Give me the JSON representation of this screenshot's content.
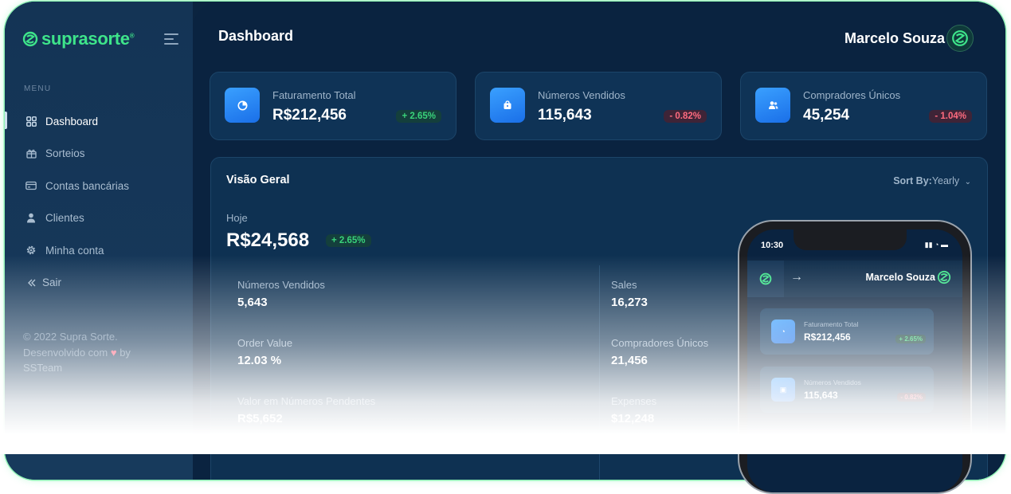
{
  "brand": {
    "name": "suprasorte",
    "mark": "®",
    "color": "#3ee48a"
  },
  "sidebar": {
    "menu_label": "MENU",
    "items": [
      {
        "label": "Dashboard",
        "icon": "grid-icon",
        "active": true
      },
      {
        "label": "Sorteios",
        "icon": "gift-icon"
      },
      {
        "label": "Contas bancárias",
        "icon": "credit-card-icon"
      },
      {
        "label": "Clientes",
        "icon": "user-icon"
      },
      {
        "label": "Minha conta",
        "icon": "gear-icon"
      },
      {
        "label": "Sair",
        "icon": "double-chevron-left-icon"
      }
    ],
    "footer": {
      "line1": "© 2022 Supra Sorte.",
      "line2a": "Desenvolvido com",
      "line2b": "by",
      "line3": "SSTeam"
    }
  },
  "header": {
    "title": "Dashboard",
    "user_name": "Marcelo Souza"
  },
  "cards": [
    {
      "label": "Faturamento Total",
      "value": "R$212,456",
      "change": "+ 2.65%",
      "trend": "up",
      "icon": "pie-chart-icon"
    },
    {
      "label": "Números Vendidos",
      "value": "115,643",
      "change": "- 0.82%",
      "trend": "down",
      "icon": "shopping-bag-icon"
    },
    {
      "label": "Compradores Únicos",
      "value": "45,254",
      "change": "- 1.04%",
      "trend": "down",
      "icon": "users-icon"
    }
  ],
  "overview": {
    "title": "Visão Geral",
    "sort_label": "Sort By:",
    "sort_value": "Yearly",
    "today_label": "Hoje",
    "today_value": "R$24,568",
    "today_change": "+ 2.65%",
    "stats_left": [
      {
        "label": "Números Vendidos",
        "value": "5,643"
      },
      {
        "label": "Order Value",
        "value": "12.03 %"
      },
      {
        "label": "Valor em Números Pendentes",
        "value": "R$5,652"
      }
    ],
    "stats_right": [
      {
        "label": "Sales",
        "value": "16,273"
      },
      {
        "label": "Compradores Únicos",
        "value": "21,456"
      },
      {
        "label": "Expenses",
        "value": "$12,248"
      }
    ]
  },
  "phone": {
    "time": "10:30",
    "user_name": "Marcelo Souza",
    "cards": [
      {
        "label": "Faturamento Total",
        "value": "R$212,456",
        "change": "+ 2.65%",
        "trend": "up"
      },
      {
        "label": "Números Vendidos",
        "value": "115,643",
        "change": "- 0.82%",
        "trend": "down"
      }
    ]
  },
  "colors": {
    "accent": "#3ee48a",
    "up": "#39d37a",
    "down": "#ff6b7f",
    "background": "#0a2340"
  }
}
